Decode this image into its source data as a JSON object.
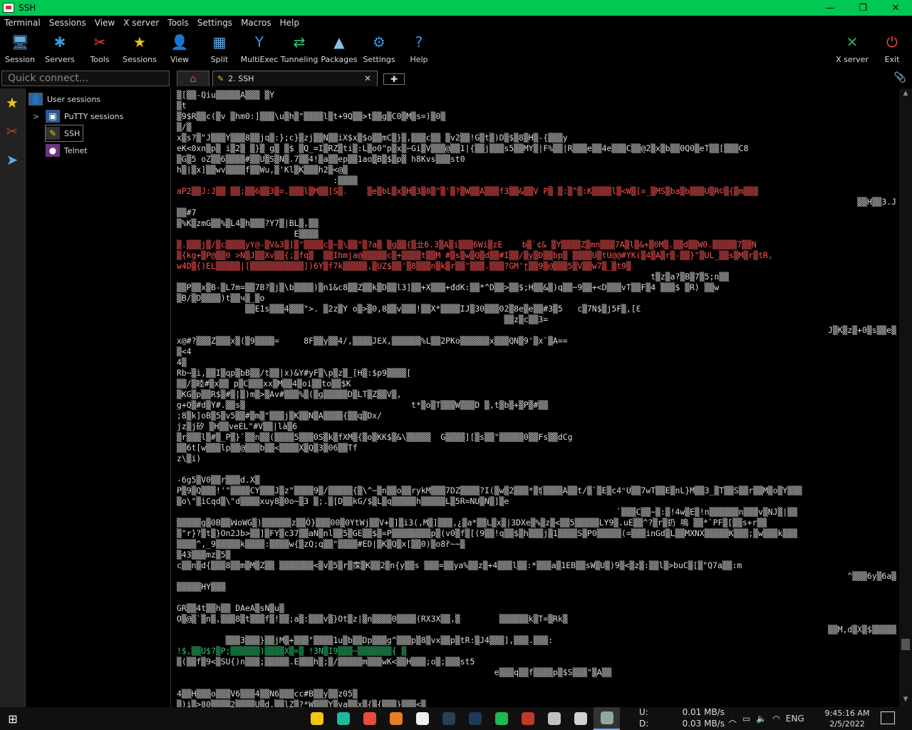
{
  "window": {
    "title": "SSH",
    "minimize": "—",
    "restore": "❐",
    "close": "✕"
  },
  "menu": [
    "Terminal",
    "Sessions",
    "View",
    "X server",
    "Tools",
    "Settings",
    "Macros",
    "Help"
  ],
  "toolbar": [
    {
      "label": "Session",
      "icon": "session-icon",
      "glyph": "🖥",
      "color": "#5dade2"
    },
    {
      "label": "Servers",
      "icon": "servers-icon",
      "glyph": "✱",
      "color": "#3498db"
    },
    {
      "label": "Tools",
      "icon": "tools-icon",
      "glyph": "✂",
      "color": "#e74c3c"
    },
    {
      "label": "Sessions",
      "icon": "star-icon",
      "glyph": "★",
      "color": "#f1c40f"
    },
    {
      "label": "View",
      "icon": "view-icon",
      "glyph": "👤",
      "color": "#95a5a6"
    },
    {
      "label": "Split",
      "icon": "split-icon",
      "glyph": "▦",
      "color": "#5dade2"
    },
    {
      "label": "MultiExec",
      "icon": "multiexec-icon",
      "glyph": "Y",
      "color": "#3498db"
    },
    {
      "label": "Tunneling",
      "icon": "tunneling-icon",
      "glyph": "⇄",
      "color": "#2ecc71"
    },
    {
      "label": "Packages",
      "icon": "packages-icon",
      "glyph": "▲",
      "color": "#85c1e9"
    },
    {
      "label": "Settings",
      "icon": "settings-icon",
      "glyph": "⚙",
      "color": "#3498db"
    },
    {
      "label": "Help",
      "icon": "help-icon",
      "glyph": "?",
      "color": "#3498db"
    }
  ],
  "toolbar_right": [
    {
      "label": "X server",
      "icon": "x-server-icon",
      "glyph": "✕",
      "color": "#27ae60"
    },
    {
      "label": "Exit",
      "icon": "exit-icon",
      "glyph": "⏻",
      "color": "#e74c3c"
    }
  ],
  "quick_connect": {
    "placeholder": "Quick connect..."
  },
  "left_strip": [
    {
      "name": "favorites-star-icon",
      "glyph": "★",
      "color": "#f1c40f"
    },
    {
      "name": "tools-strip-icon",
      "glyph": "✂",
      "color": "#c0392b"
    },
    {
      "name": "send-strip-icon",
      "glyph": "➤",
      "color": "#5dade2"
    }
  ],
  "tree": {
    "root": "User sessions",
    "putty": "PuTTY sessions",
    "ssh": "SSH",
    "telnet": "Telnet",
    "expander": ">"
  },
  "tabs": {
    "home_glyph": "⌂",
    "session_label": "2. SSH",
    "close": "✕",
    "new": "✚",
    "attach": "📎"
  },
  "terminal_lines": [
    {
      "t": "▒[▒▒-Qiu▒▒▒▒▒A▒▒▒ ▒Y",
      "c": ""
    },
    {
      "t": "▒t",
      "c": ""
    },
    {
      "t": "▒9$R▒▒c(▒v ▒hm0:]▒▒▒\\u▒h▒\"▒▒▒▒l▒t+9Q▒▒>t▒▒g▒C0▒M▒s=)▒0▒",
      "c": ""
    },
    {
      "t": "▒/▒",
      "c": ""
    },
    {
      "t": "x▒s?▒\"J▒▒▒Y▒▒▒8▒▒jq▒:};c}▒zj▒▒N▒▒iX$x▒$o▒▒mC▒}▒,▒▒▒c▒▒ ▒v2▒▒!G▒t▒)D▒$▒8▒H▒-{▒▒▒y",
      "c": ""
    },
    {
      "t": "eK<0xn▒p▒ i▒2▒ ▒}▒ g▒ ▒$ ▒Q_=I▒RZ▒ti▒:L▒o0\"p▒x▒~Gi▒V▒▒▒@▒▒1|{▒▒j▒▒▒s5▒▒MY▒|F%▒▒|R▒▒▒e▒▒4e▒▒▒C▒▒@2▒x▒b▒▒0Q0▒eT▒▒[▒▒▒C8",
      "c": ""
    },
    {
      "t": "▒G▒5 oZ▒▒6▒▒▒▒#▒▒U▒S▒N▒.7▒▒4!▒a▒▒ep▒▒1ao▒B▒$▒p▒ h8Kvs▒▒▒st0",
      "c": ""
    },
    {
      "t": "h▒|▒x]▒▒wv▒▒▒▒f▒▒Wu,▒'Kl▒K▒▒▒h2▒<@▒",
      "c": ""
    },
    {
      "t": "                                :▒▒▒▒",
      "c": ""
    },
    {
      "t": "aP2▒▒J:J▒▒ ▒▒;▒▒6▒▒3▒=.▒▒▒l▒M▒▒[S▒.    ▒e▒bL▒x▒H▒3▒8▒^▒'▒?▒W▒▒A▒▒▒f3▒▒&▒▒V P▒ ▒:▒^▒:K▒▒▒▒l▒<W▒[=_▒MS▒ba▒b▒▒▒U▒R©▒{▒m▒▒▒",
      "c": "red"
    },
    {
      "t": "▒▒H▒▒3.J",
      "c": "right"
    },
    {
      "t": "▒▒#7",
      "c": ""
    },
    {
      "t": "▒%K▒zmG▒▒%▒L4▒h▒▒▒?Y7▒|BL▒,▒▒",
      "c": ""
    },
    {
      "t": "                        E▒▒▒▒",
      "c": ""
    },
    {
      "t": "▒.▒▒▒j▒/▒c▒▒▒▒yY@-▒V&3▒]▒\"▒▒▒▒c▒~▒\\▒▒\"▒?a▒ ▒g▒▒{▒㐀6.3▒A▒i▒▒▒6Wi▒zE    b▒`¢& ▒Y▒▒▒▒Z▒mn▒▒▒7A▒l▒&+▒0M▒.▒▒d▒▒W0.▒▒▒▒▒7▒▒N",
      "c": "red"
    },
    {
      "t": "▒{kg+▒P@▒▒0 >N▒J▒▒Xv▒▒{;▒fq▒  ▒▒Ihmja@▒▒▒▒▒c▒+▒▒▒▒t▒▒M #▒s▒w▒Q▒d▒▒#I▒▒/▒y▒D▒▒bp▒ ▒▒▒▒U▒tU@@#YK(▒4▒A▒r▒-▒▒}\"▒UL_▒▒s▒M▒r▒tR,",
      "c": "red"
    },
    {
      "t": "w4D▒{)EL▒▒▒▒▒|[▒▒▒▒▒▒▒▒▒▒▒])6Y▒f7k▒▒▒▒▒,▒UZ$▒▒'▒8▒▒▒n▒k▒r▒▒\"▒▒▒.▒▒▒?GM'ʈ▒▒9▒@▒▒▒5▒V▒▒w7▒_▒t9▒",
      "c": "red"
    },
    {
      "t": "                                                                                                 t▒z▒a?▒B▒7▒5;n▒▒",
      "c": ""
    },
    {
      "t": "▒▒P▒▒x▒B-▒L7m=▒▒7B?▒j▒\\b▒▒▒▒)▒n1&c8▒▒Z▒▒k▒D▒▒l3]▒▒+X▒▒▒+đdK:▒▒*^D▒▒>▒▒$;H▒▒&▒)q▒▒~9▒▒+<D▒▒▒vT▒▒F▒4 ▒▒▒$ ▒R) ▒▒w",
      "c": ""
    },
    {
      "t": "▒B/▒D▒▒▒▒)t▒▒ч▒_▒o",
      "c": ""
    },
    {
      "t": "              ▒▒E1s▒▒▒4▒▒▒\">. ▒2z▒Y o▒>▒0,8▒▒v▒▒▒!▒▒X*▒▒▒▒IJ▒30▒▒▒02▒8e▒e▒▒#3▒5   c▒7N$▒j5F▒,[Ɛ",
      "c": ""
    },
    {
      "t": "                                                                   ▒▒z▒c▒▒3=",
      "c": ""
    },
    {
      "t": "J▒K▒z▒+0▒s▒▒e▒",
      "c": "right"
    },
    {
      "t": "x@#?▒▒▒Z▒▒▒x▒(▒9▒▒▒▒=     8F▒▒y▒▒4/,▒▒▒▒JEX,▒▒▒▒▒▒%L▒▒2PKo▒▒▒▒▒▒x▒▒▒QN▒9'▒x`▒A==",
      "c": ""
    },
    {
      "t": "▒<4",
      "c": ""
    },
    {
      "t": "4▒",
      "c": ""
    },
    {
      "t": "Rb~▒i,▒▒I▒qp▒bB▒▒/t▒▒|x)&Y#yF▒\\p▒z▒_[H▒:$p9▒▒▒▒[",
      "c": ""
    },
    {
      "t": "▒▒/▒睦#▒x▒▒ p▒C▒▒▒xx▒M▒▒4▒oi▒▒to▒▒$K",
      "c": ""
    },
    {
      "t": "▒KG▒p▒▒R$▒#▒|▒)m▒>▒Av#▒▒▒%▒(▒g▒▒▒▒▒D▒LT▒Z▒▒V▒,",
      "c": ""
    },
    {
      "t": "g+Q▒#d▒Y#.▒▒s▒                                  t*▒o▒T▒▒▒W▒▒▒D ▒,t▒b▒+▒P▒#▒▒",
      "c": ""
    },
    {
      "t": ";8▒k]oB▒5▒v5▒▒#▒m▒\"▒▒▒j▒K▒▒N▒A▒▒▒▒{▒▒q▒Dx/",
      "c": ""
    },
    {
      "t": "jz▒j矽 ▒H▒▒veEL\"#V▒▒|là▒6",
      "c": ""
    },
    {
      "t": "▒r▒▒▒l▒#▒_P▒}`▒▒n▒▒(▒▒▒▒5▒▒▒0S▒k▒fXM▒{▒o▒KK$▒&\\▒▒▒▒▒  G▒▒▒▒][▒s▒▒\"▒▒▒▒▒0▒▒Fs▒▒dCg",
      "c": ""
    },
    {
      "t": "▒▒6t[w▒▒▒lp▒▒@▒▒▒b▒▒<▒▒▒▒X▒Q▒3▒06▒▒Tf",
      "c": ""
    },
    {
      "t": "z\\▒i)",
      "c": ""
    },
    {
      "t": "",
      "c": ""
    },
    {
      "t": "-6g5▒V0▒▒r▒▒▒d.X▒",
      "c": ""
    },
    {
      "t": "P▒9▒Q▒▒▒!'\"▒▒▒▒CY▒▒▒J▒z\"▒▒▒▒9▒/▒▒▒▒▒{▒\\^~▒n▒▒o▒▒rykM▒▒▒7DZ▒▒▒▒?I(▒w▒2▒▒▒*▒ʧ▒▒▒▒A▒▒t/▒`▒E▒c4ⁿU▒▒7wT▒▒E▒nL}M▒▒3_▒T▒▒S▒▒r▒▒M▒o▒Y▒▒▒",
      "c": ""
    },
    {
      "t": "▒o\\\"▒iCqd▒\\\"d▒▒▒▒xuy8▒0o~▒3 ▒;.▒[D▒▒kG/$▒L▒q▒▒▒▒▒h▒▒▒▒▒L▒5R=NU▒N▒]▒e",
      "c": ""
    },
    {
      "t": "                                                                                          `▒▒▒C▒▒~▒:▒!4w▒E▒!n▒▒▒▒▒▒n▒▒▒v▒NJ▒|▒▒",
      "c": ""
    },
    {
      "t": "▒▒▒▒▒g▒0B▒▒ꟽoWG▒)▒▒▒▒▒▒z▒▒Ô}▒▒▒00▒0YtWj▒▒V+▒]▒i3(,M▒]▒▒▒,¿▒a*▒▒L▒x▒|3DXe▒%▒z▒<▒▒5▒▒▒▒▒LY9▒.uE▒▒^?▒r▒扔 嗚 ▒▒*`PF▒[▒▒s+r▒▒",
      "c": ""
    },
    {
      "t": "▒\"r}?▒t▒}On2Jb>▒▒]▒FY▒c37▒▒aN▒nl▒▒5▒GE▒▒$▒=P▒▒▒▒▒▒▒▒p▒(v0▒f▒[(9▒▒!q▒▒$▒h▒▒▒j▒1▒▒▒▒S▒P0▒▒▒▒▒(=▒▒▒inGd▒L▒▒MXNX▒▒▒▒▒K▒▒▒;▒w▒▒▒k▒▒▒",
      "c": ""
    },
    {
      "t": "▒▒▒▒^,_9▒▒▒▒▒k▒▒▒▒:▒▒▒▒w{▒zQ;q▒▒\"▒▒▒▒#ED|▒K▒Q▒x[▒▒0)▒o8r̃~~▒",
      "c": ""
    },
    {
      "t": "▒43▒▒▒mz▒5▒",
      "c": ""
    },
    {
      "t": "c▒▒n▒d{▒▒▒8▒▒m▒M▒Z▒▒ ▒▒▒▒▒▒▒<▒v▒5▒r▒霂▒K▒▒2▒n{y▒▒s ▒▒▒=▒▒ya%▒▒z▒+4▒▒▒l▒▒:*▒▒▒a▒1EB▒▒sW▒U▒)9▒<▒z▒:▒▒l▒>buC▒[▒\"Q7a▒▒:m",
      "c": ""
    },
    {
      "t": "^▒▒▒6y▒6a▒",
      "c": "right"
    },
    {
      "t": "▒▒▒▒▒HY▒▒▒",
      "c": ""
    },
    {
      "t": "",
      "c": ""
    },
    {
      "t": "GR▒▒4t▒▒h▒▒ DAeA▒sN▒u▒",
      "c": ""
    },
    {
      "t": "O▒@▒`▒n▒,▒▒▒8▒t▒▒▒f▒!▒▒;a▒:▒▒▒v▒}Ot▒z|▒n▒▒▒▒0▒▒▒▒(RX3X▒▒,▒        ▒▒▒▒▒▒k▒T=▒Rk▒",
      "c": ""
    },
    {
      "t": "▒▒M,d▒X▒$▒▒▒▒▒",
      "c": "right"
    },
    {
      "t": "          ▒▒▒3▒▒▒}▒▒jM▒+▒▒▒\"▒▒▒▒1u▒b▒▒Dp▒▒▒g^▒▒▒p▒8▒vx▒▒p▒tR:▒J4▒▒▒],▒▒▒.▒▒▒:",
      "c": ""
    },
    {
      "t": "!$,▒▒U$?▒P;▒▒▒▒▒▒)▒▒▒▒X▒=▒ !3N▒I9▒▒▒~▒▒▒▒▒▒▒{ ▒",
      "c": "grn"
    },
    {
      "t": "▒(▒▒f▒9<▒SU{)n▒▒▒;▒▒▒▒▒.E▒▒▒h▒;▒/▒▒▒▒▒m▒▒▒wK<▒▒H▒▒▒;o▒;▒▒▒st5",
      "c": ""
    },
    {
      "t": "                                                                 e▒▒▒q▒▒f▒▒▒▒p▒$S▒▒▒\"▒A▒▒",
      "c": ""
    },
    {
      "t": "",
      "c": ""
    },
    {
      "t": "4▒▒H▒▒▒o▒▒▒V6▒▒▒4▒▒N6▒▒▒cc#B▒▒y▒▒z05▒",
      "c": ""
    },
    {
      "t": "▒)i▒>80▒▒▒▒2▒▒▒▒U▒d,▒▒lZ▒?*W▒▒▒Y▒ya▒▒x▒{▒{▒▒▒}▒▒▒<▒",
      "c": ""
    }
  ],
  "taskbar": {
    "start": "⊞",
    "apps": [
      {
        "name": "file-explorer-icon",
        "color": "#f1c40f"
      },
      {
        "name": "edge-icon",
        "color": "#1abc9c"
      },
      {
        "name": "chrome-icon",
        "color": "#e74c3c"
      },
      {
        "name": "firefox-icon",
        "color": "#e67e22"
      },
      {
        "name": "notepad-icon",
        "color": "#ecf0f1"
      },
      {
        "name": "lightroom-icon",
        "color": "#2c3e50"
      },
      {
        "name": "photoshop-icon",
        "color": "#1b3a5c"
      },
      {
        "name": "spotify-icon",
        "color": "#1db954"
      },
      {
        "name": "teamviewer-icon",
        "color": "#c0392b"
      },
      {
        "name": "network-app-icon",
        "color": "#bdc3c7"
      },
      {
        "name": "media-app-icon",
        "color": "#d0d0d0"
      },
      {
        "name": "mobaxterm-icon",
        "color": "#95a5a6"
      }
    ],
    "net_up_label": "U:",
    "net_up": "0.01 MB/s",
    "net_down_label": "D:",
    "net_down": "0.03 MB/s",
    "tray_chevron": "︿",
    "language": "ENG",
    "time": "9:45:16 AM",
    "date": "2/5/2022"
  }
}
